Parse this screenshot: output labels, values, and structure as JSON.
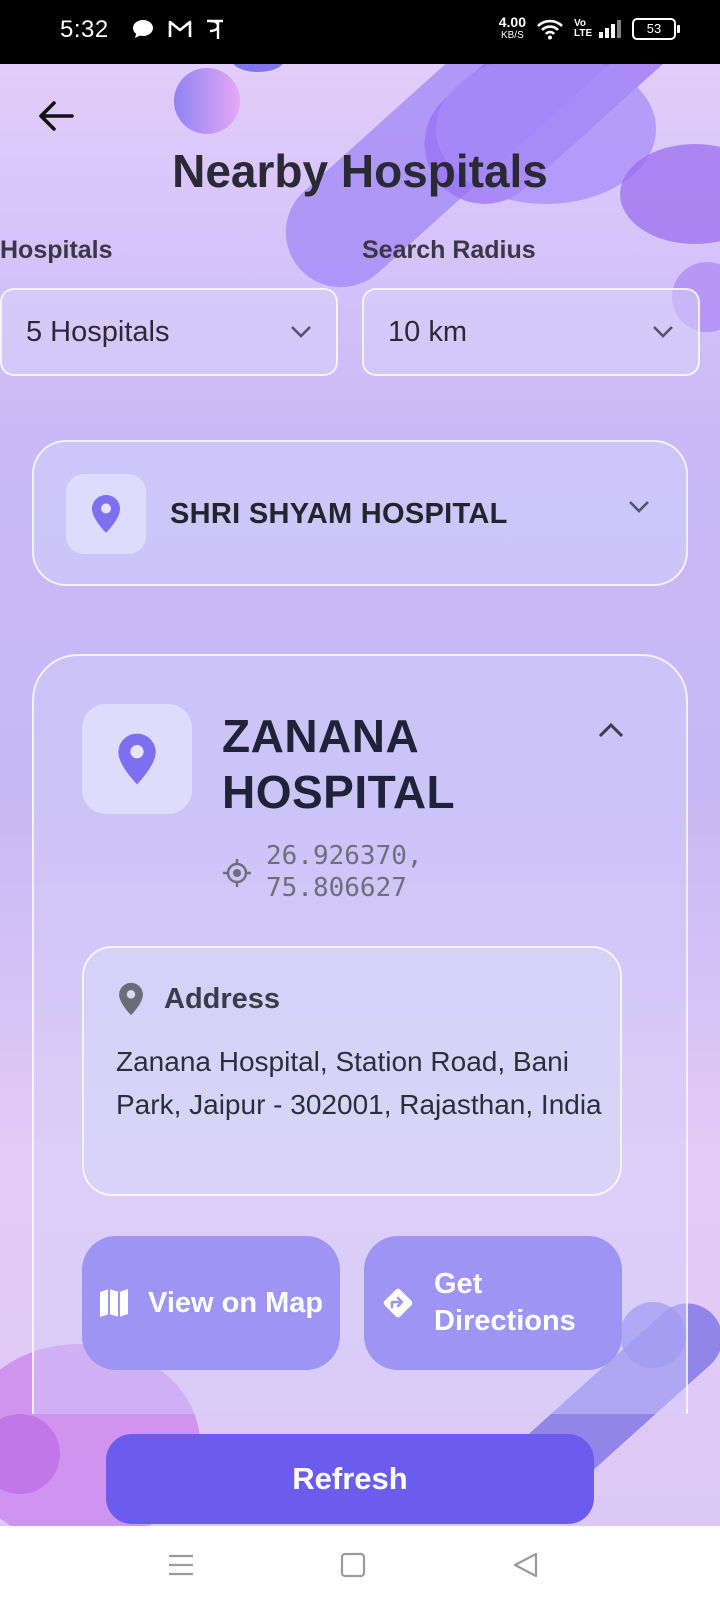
{
  "status_bar": {
    "time": "5:32",
    "left_icons": [
      "chat-bubble-icon",
      "gmail-icon",
      "phonepe-icon"
    ],
    "net_speed_value": "4.00",
    "net_speed_unit": "KB/S",
    "volte_label": "Vo LTE",
    "battery": "53"
  },
  "header": {
    "title": "Nearby Hospitals"
  },
  "filters": {
    "hospitals_label": "Hospitals",
    "hospitals_value": "5 Hospitals",
    "radius_label": "Search Radius",
    "radius_value": "10 km"
  },
  "hospitals": [
    {
      "name": "SHRI SHYAM HOSPITAL",
      "expanded": false
    },
    {
      "name": "ZANANA HOSPITAL",
      "expanded": true,
      "coordinates": "26.926370,\n75.806627",
      "address_label": "Address",
      "address": "Zanana Hospital, Station Road, Bani Park, Jaipur - 302001, Rajasthan, India",
      "view_map_label": "View on Map",
      "directions_label": "Get Directions"
    }
  ],
  "refresh_label": "Refresh",
  "colors": {
    "primary": "#6c5cee",
    "action_button": "#9e94f4",
    "pin": "#7d70f0",
    "title_text": "#2a2a36"
  }
}
